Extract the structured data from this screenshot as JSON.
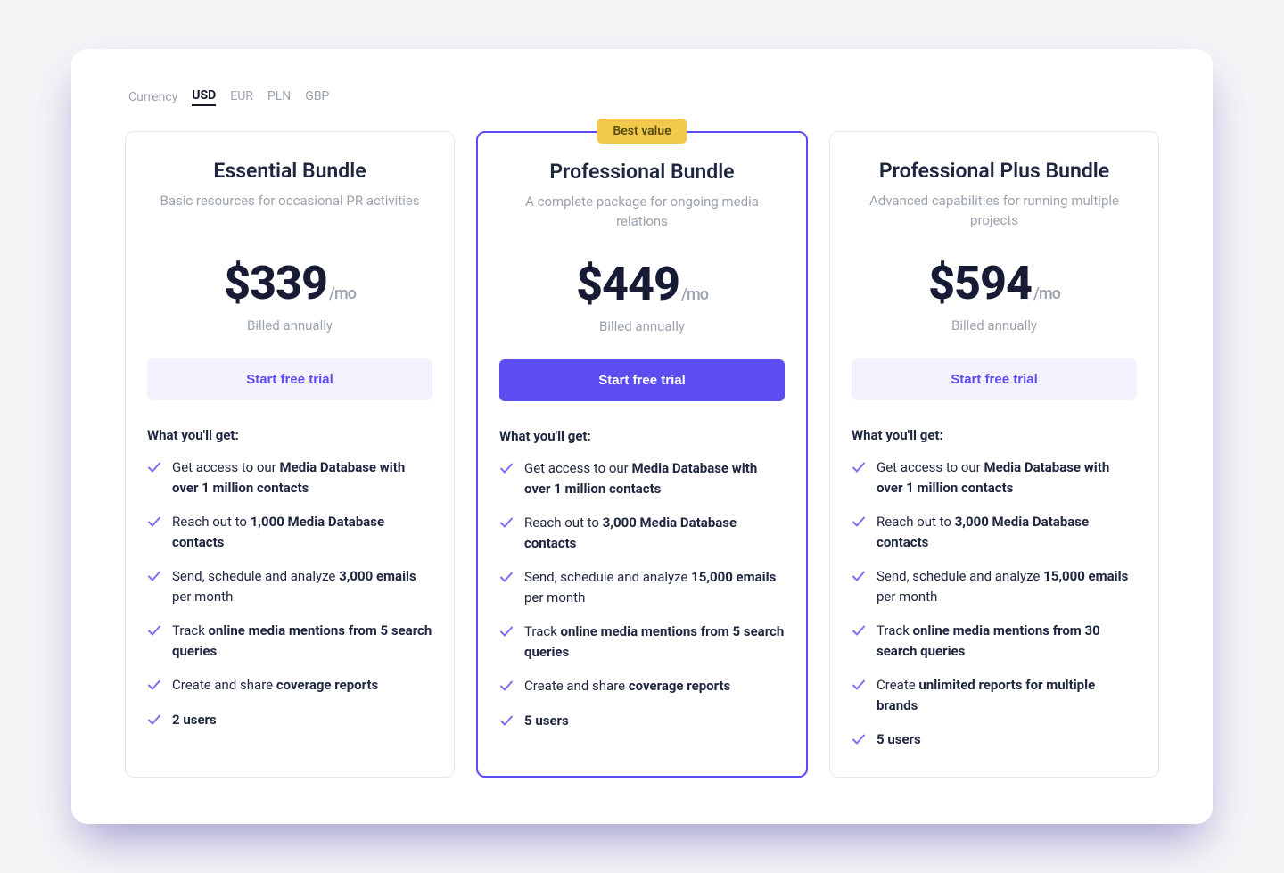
{
  "currency": {
    "label": "Currency",
    "options": [
      "USD",
      "EUR",
      "PLN",
      "GBP"
    ],
    "active": "USD"
  },
  "common": {
    "per": "/mo",
    "billed": "Billed annually",
    "cta": "Start free trial",
    "features_heading": "What you'll get:"
  },
  "badge": "Best value",
  "plans": [
    {
      "title": "Essential Bundle",
      "subtitle": "Basic resources for occasional PR activities",
      "price": "$339",
      "highlight": false,
      "features": [
        "Get access to our <strong>Media Database with over 1 million contacts</strong>",
        "Reach out to <strong>1,000 Media Database contacts</strong>",
        "Send, schedule and analyze <strong>3,000 emails</strong> per month",
        "Track <strong>online media mentions from 5 search queries</strong>",
        "Create and share <strong>coverage reports</strong>",
        "<strong>2 users</strong>"
      ]
    },
    {
      "title": "Professional Bundle",
      "subtitle": "A complete package for ongoing media relations",
      "price": "$449",
      "highlight": true,
      "features": [
        "Get access to our <strong>Media Database with over 1 million contacts</strong>",
        "Reach out to <strong>3,000 Media Database contacts</strong>",
        "Send, schedule and analyze <strong>15,000 emails</strong> per month",
        "Track <strong>online media mentions from 5 search queries</strong>",
        "Create and share <strong>coverage reports</strong>",
        "<strong>5 users</strong>"
      ]
    },
    {
      "title": "Professional Plus Bundle",
      "subtitle": "Advanced capabilities for running multiple projects",
      "price": "$594",
      "highlight": false,
      "features": [
        "Get access to our <strong>Media Database with over 1 million contacts</strong>",
        "Reach out to <strong>3,000 Media Database contacts</strong>",
        "Send, schedule and analyze <strong>15,000 emails</strong> per month",
        "Track <strong>online media mentions from 30 search queries</strong>",
        "Create <strong>unlimited reports for multiple brands</strong>",
        "<strong>5 users</strong>"
      ]
    }
  ]
}
